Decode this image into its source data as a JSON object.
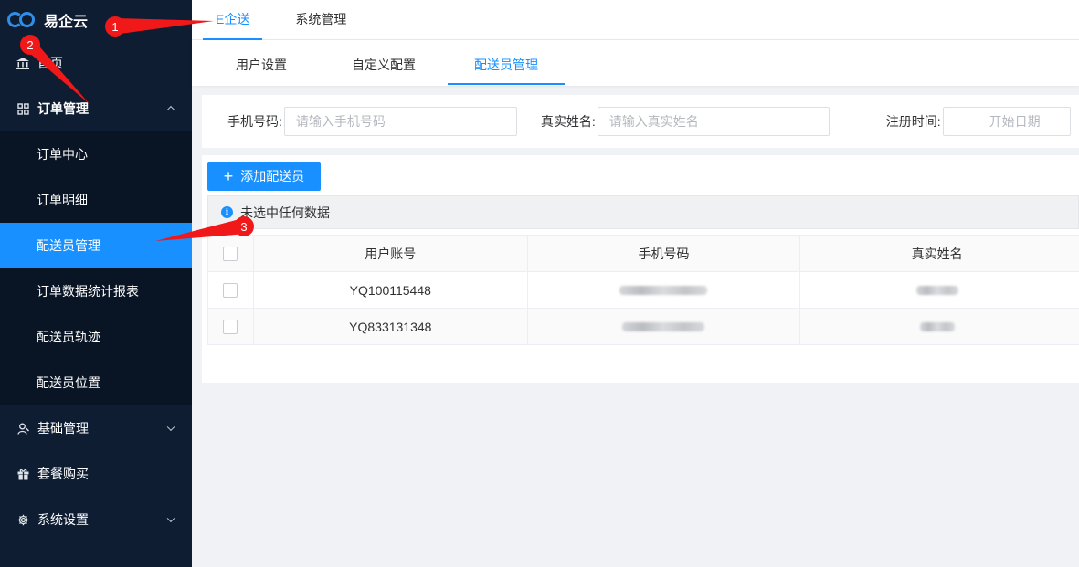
{
  "app": {
    "name": "易企云"
  },
  "sidebar": {
    "items": [
      {
        "label": "首页",
        "icon": "bank-icon"
      },
      {
        "label": "订单管理",
        "icon": "grid-icon",
        "expanded": true,
        "children": [
          "订单中心",
          "订单明细",
          "配送员管理",
          "订单数据统计报表",
          "配送员轨迹",
          "配送员位置"
        ],
        "active_child": "配送员管理"
      },
      {
        "label": "基础管理",
        "icon": "user-icon"
      },
      {
        "label": "套餐购买",
        "icon": "gift-icon"
      },
      {
        "label": "系统设置",
        "icon": "gear-icon"
      }
    ]
  },
  "header": {
    "tabs": [
      {
        "label": "E企送",
        "active": true
      },
      {
        "label": "系统管理",
        "active": false
      }
    ],
    "subtabs": [
      {
        "label": "用户设置",
        "active": false
      },
      {
        "label": "自定义配置",
        "active": false
      },
      {
        "label": "配送员管理",
        "active": true
      }
    ]
  },
  "filter": {
    "phone_label": "手机号码:",
    "phone_placeholder": "请输入手机号码",
    "name_label": "真实姓名:",
    "name_placeholder": "请输入真实姓名",
    "date_label": "注册时间:",
    "date_placeholder": "开始日期"
  },
  "toolbar": {
    "add_label": "添加配送员"
  },
  "notice": {
    "text": "未选中任何数据"
  },
  "table": {
    "columns": [
      "用户账号",
      "手机号码",
      "真实姓名"
    ],
    "rows": [
      {
        "account": "YQ100115448"
      },
      {
        "account": "YQ833131348"
      }
    ]
  },
  "annotations": {
    "marker_1": "1",
    "marker_2": "2",
    "marker_3": "3",
    "color": "#f01818"
  },
  "colors": {
    "sidebar_bg": "#0f1d33",
    "accent": "#1890ff"
  }
}
